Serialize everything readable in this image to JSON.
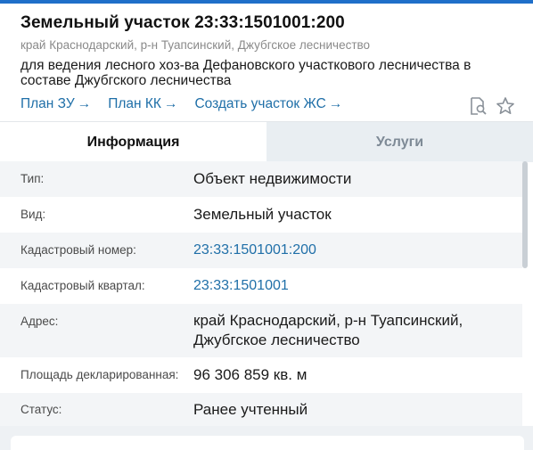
{
  "header": {
    "title": "Земельный участок 23:33:1501001:200",
    "subtitle": "край Краснодарский, р-н Туапсинский, Джубгское лесничество",
    "purpose": "для ведения лесного хоз-ва Дефановского участкового лесничества в составе Джубгского лесничества",
    "links": [
      {
        "label": "План ЗУ",
        "arrow": "→"
      },
      {
        "label": "План КК",
        "arrow": "→"
      },
      {
        "label": "Создать участок ЖС",
        "arrow": "→"
      }
    ],
    "icons": [
      "document-search-icon",
      "star-icon"
    ]
  },
  "tabs": [
    {
      "label": "Информация",
      "active": true
    },
    {
      "label": "Услуги",
      "active": false
    }
  ],
  "info": {
    "rows": [
      {
        "label": "Тип:",
        "value": "Объект недвижимости"
      },
      {
        "label": "Вид:",
        "value": "Земельный участок"
      },
      {
        "label": "Кадастровый номер:",
        "value": "23:33:1501001:200"
      },
      {
        "label": "Кадастровый квартал:",
        "value": "23:33:1501001"
      },
      {
        "label": "Адрес:",
        "value": "край Краснодарский, р-н Туапсинский, Джубгское лесничество"
      },
      {
        "label": "Площадь декларированная:",
        "value": "96 306 859 кв. м"
      },
      {
        "label": "Статус:",
        "value": "Ранее учтенный"
      }
    ]
  },
  "colors": {
    "accent": "#1f6fa8",
    "topbar": "#1f6fc9",
    "row_alt": "#f3f5f7",
    "tab_inactive": "#e9eef2"
  }
}
